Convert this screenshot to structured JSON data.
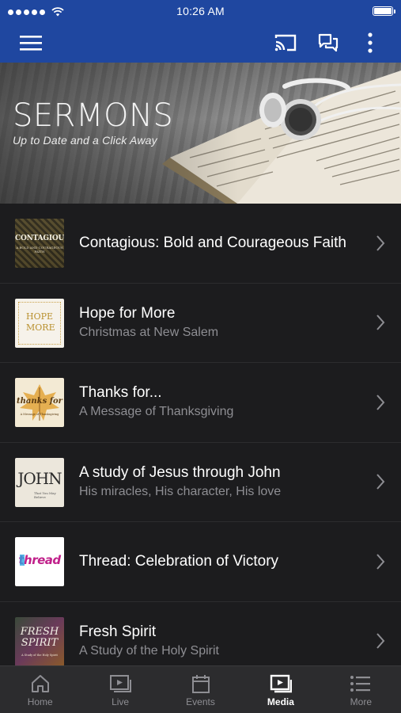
{
  "status": {
    "time": "10:26 AM"
  },
  "hero": {
    "title": "SERMONS",
    "subtitle": "Up to Date and a Click Away"
  },
  "icons": {
    "menu": "hamburger-menu-icon",
    "cast": "cast-icon",
    "chat": "chat-bubbles-icon",
    "more": "more-vertical-icon",
    "chevron": "chevron-right-icon"
  },
  "sermons": [
    {
      "title": "Contagious: Bold and Courageous Faith",
      "subtitle": "",
      "thumb_text": "CONTAGIOUS",
      "thumb_sub": "A BOLD AND COURAGEOUS FAITH"
    },
    {
      "title": "Hope for More",
      "subtitle": "Christmas at New Salem",
      "thumb_text": "HOPE MORE",
      "thumb_sub": ""
    },
    {
      "title": "Thanks for...",
      "subtitle": "A Message of Thanksgiving",
      "thumb_text": "thanks for",
      "thumb_sub": "A Message of Thanksgiving"
    },
    {
      "title": "A study of Jesus through John",
      "subtitle": "His miracles, His character, His love",
      "thumb_text": "JOHN",
      "thumb_sub": "That You May Believe"
    },
    {
      "title": "Thread: Celebration of Victory",
      "subtitle": "",
      "thumb_text": "thread",
      "thumb_sub": ""
    },
    {
      "title": "Fresh Spirit",
      "subtitle": "A Study of the Holy Spirit",
      "thumb_text": "FRESH SPIRIT",
      "thumb_sub": "A Study of the Holy Spirit"
    }
  ],
  "tabs": [
    {
      "label": "Home",
      "icon": "home-icon",
      "active": false
    },
    {
      "label": "Live",
      "icon": "live-play-icon",
      "active": false
    },
    {
      "label": "Events",
      "icon": "calendar-icon",
      "active": false
    },
    {
      "label": "Media",
      "icon": "media-play-icon",
      "active": true
    },
    {
      "label": "More",
      "icon": "list-icon",
      "active": false
    }
  ],
  "colors": {
    "header": "#1f47a0",
    "background": "#1c1c1e",
    "tabbar": "#2c2c2e",
    "subtitle": "#8e8e93"
  }
}
